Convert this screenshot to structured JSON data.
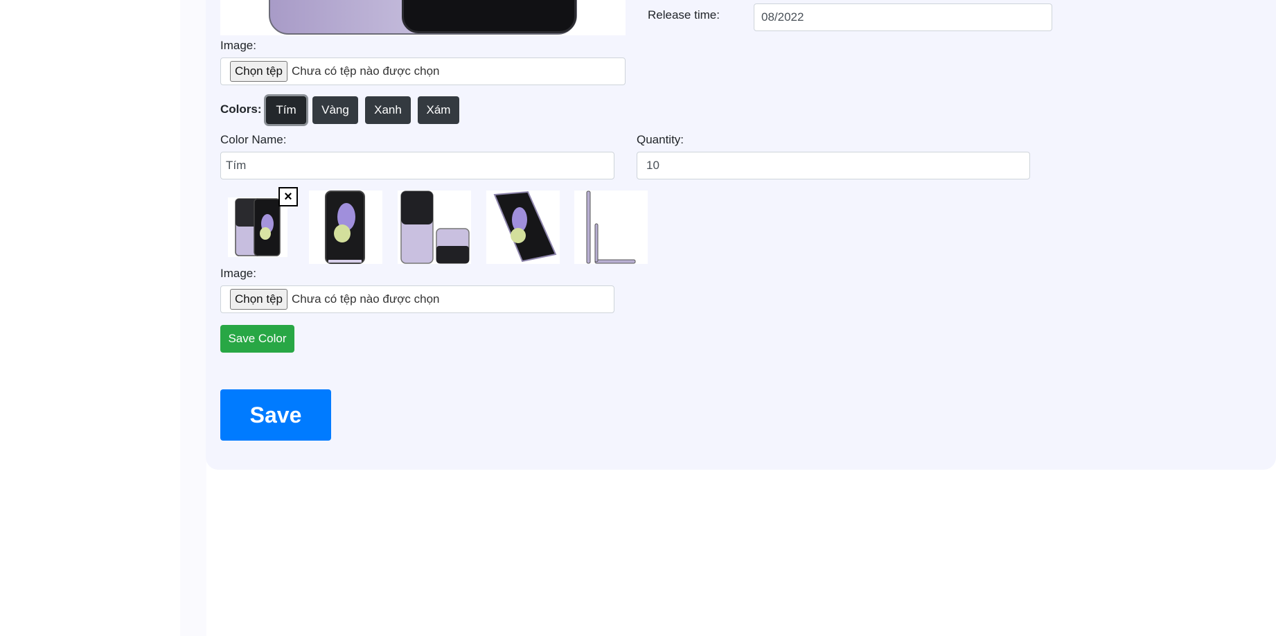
{
  "product": {
    "image_label": "Image:",
    "file_button": "Chọn tệp",
    "file_status": "Chưa có tệp nào được chọn",
    "release_label": "Release time:",
    "release_value": "08/2022"
  },
  "colors": {
    "label": "Colors:",
    "items": [
      {
        "label": "Tím",
        "active": true
      },
      {
        "label": "Vàng",
        "active": false
      },
      {
        "label": "Xanh",
        "active": false
      },
      {
        "label": "Xám",
        "active": false
      }
    ]
  },
  "color_form": {
    "name_label": "Color Name:",
    "name_value": "Tím",
    "quantity_label": "Quantity:",
    "quantity_value": "10",
    "image_label": "Image:",
    "file_button": "Chọn tệp",
    "file_status": "Chưa có tệp nào được chọn",
    "remove_icon": "×",
    "save_color_label": "Save Color"
  },
  "save_label": "Save",
  "theme": {
    "primary": "#007bff",
    "success": "#28a745",
    "dark": "#343a40",
    "panel_bg": "#f4f5fe",
    "phone_lavender": "#c2b9da"
  }
}
